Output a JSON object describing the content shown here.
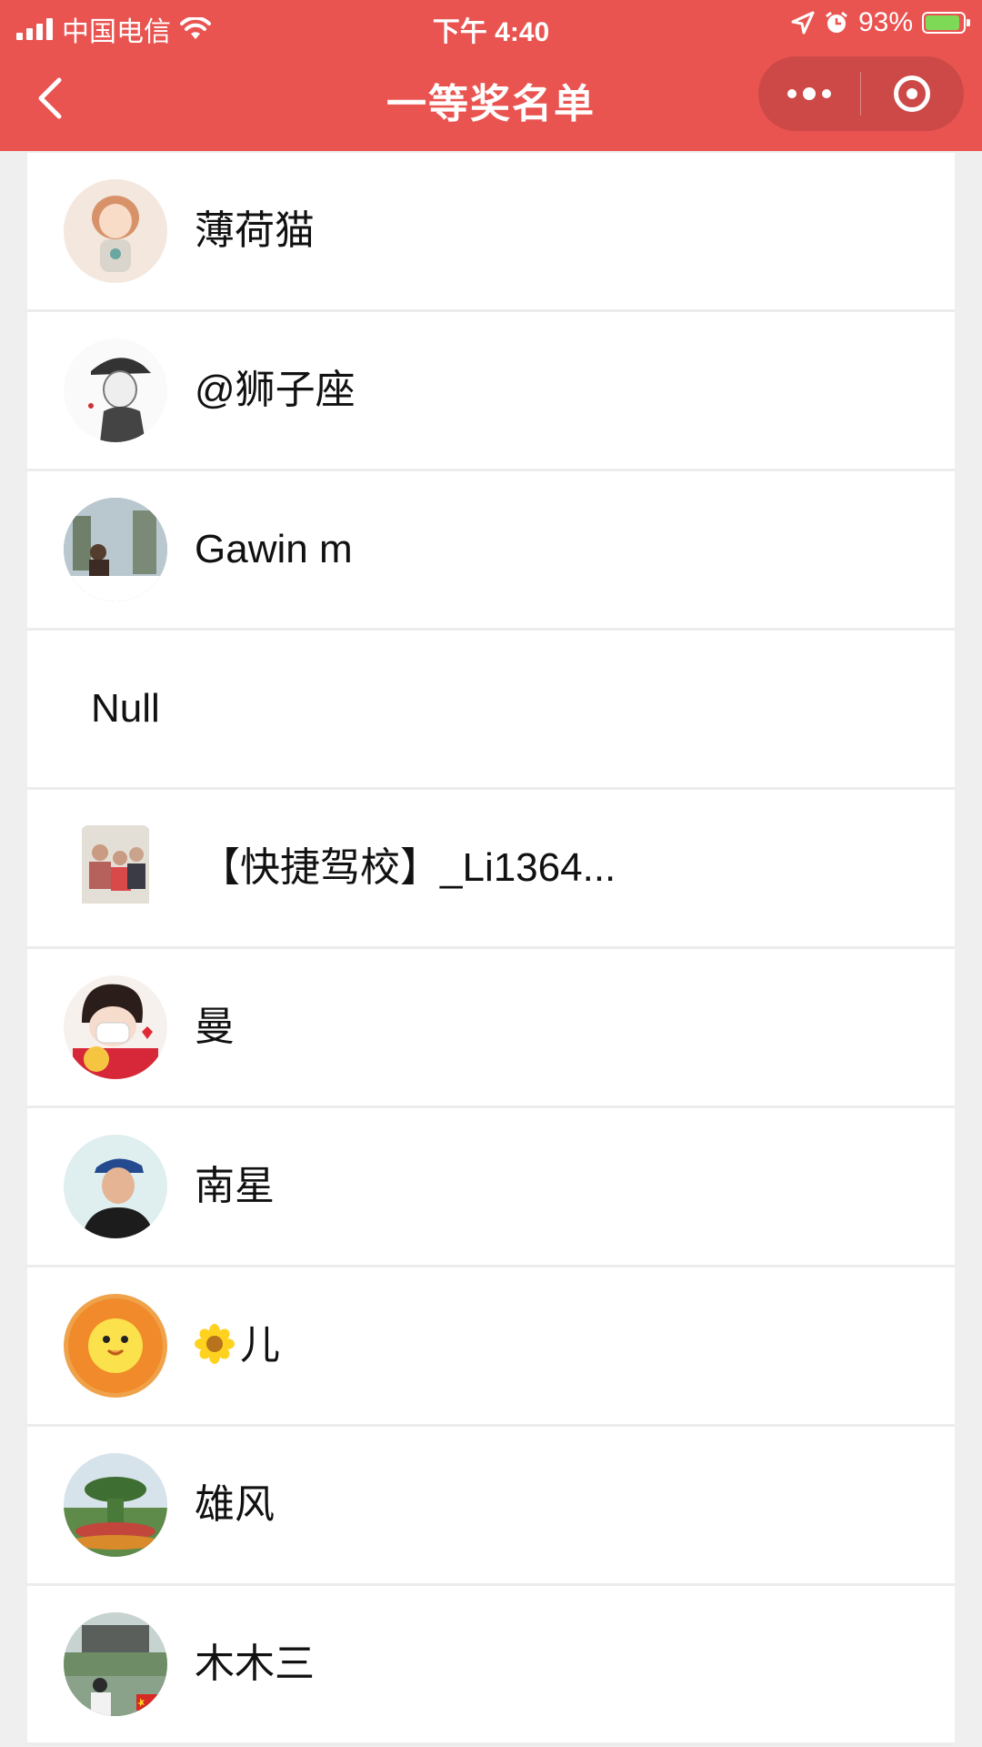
{
  "status_bar": {
    "carrier": "中国电信",
    "time": "下午 4:40",
    "battery": "93%",
    "battery_level": 0.93
  },
  "nav": {
    "title": "一等奖名单"
  },
  "winners": [
    {
      "name": "薄荷猫",
      "avatar": "girl-illustration-avatar"
    },
    {
      "name": "@狮子座",
      "avatar": "sketch-cap-avatar"
    },
    {
      "name": "Gawin m",
      "avatar": "photo-outdoor-avatar"
    },
    {
      "name": "Null",
      "avatar": null
    },
    {
      "name": "【快捷驾校】_Li1364...",
      "avatar": "family-photo-avatar"
    },
    {
      "name": "曼",
      "avatar": "cartoon-girl-mask-avatar"
    },
    {
      "name": "南星",
      "avatar": "man-cap-avatar"
    },
    {
      "name": "儿",
      "avatar": "sunflower-toy-avatar",
      "prefix_icon": "flower-emoji-icon"
    },
    {
      "name": "雄风",
      "avatar": "garden-photo-avatar"
    },
    {
      "name": "木木三",
      "avatar": "lake-child-avatar"
    }
  ],
  "colors": {
    "header_bg": "#e95451",
    "page_bg": "#efefef",
    "battery_fill": "#7ed957"
  }
}
